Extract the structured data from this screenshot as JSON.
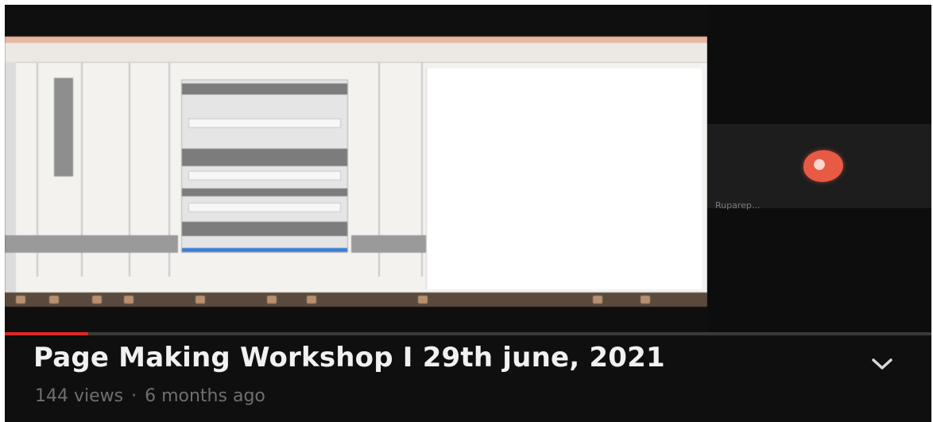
{
  "video": {
    "title": "Page Making Workshop I 29th june, 2021",
    "views": "144 views",
    "separator": "·",
    "age": "6 months ago",
    "progress_fraction": 0.09,
    "progress_color": "#e0271f"
  },
  "participant": {
    "name": "Ruparep...",
    "avatar_icon": "participant-avatar-icon"
  },
  "icons": {
    "expand": "chevron-down-icon"
  }
}
